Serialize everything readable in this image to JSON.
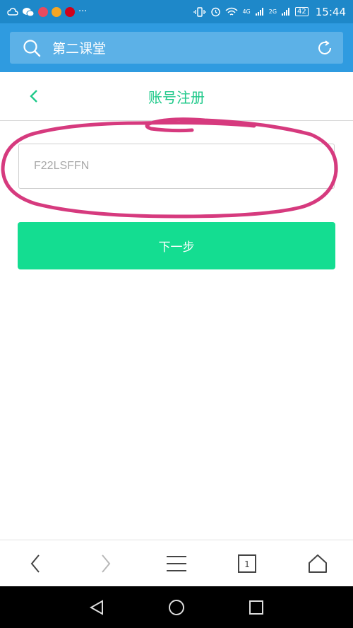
{
  "status_bar": {
    "time": "15:44",
    "battery": "42",
    "network_4g": "4G",
    "network_2g": "2G",
    "more": "···"
  },
  "browser": {
    "address_text": "第二课堂"
  },
  "page": {
    "title": "账号注册"
  },
  "form": {
    "input_value": "F22LSFFN",
    "next_label": "下一步"
  },
  "toolbar": {
    "tab_count": "1"
  },
  "colors": {
    "status_bar": "#1e88c9",
    "browser_bar": "#2f9be0",
    "title_green": "#1fc98a",
    "button_green": "#14dd91",
    "annotation": "#d63a7e"
  },
  "icons": {
    "back": "chevron-left-icon",
    "search": "search-icon",
    "refresh": "refresh-icon",
    "menu": "menu-icon",
    "home": "home-icon"
  }
}
